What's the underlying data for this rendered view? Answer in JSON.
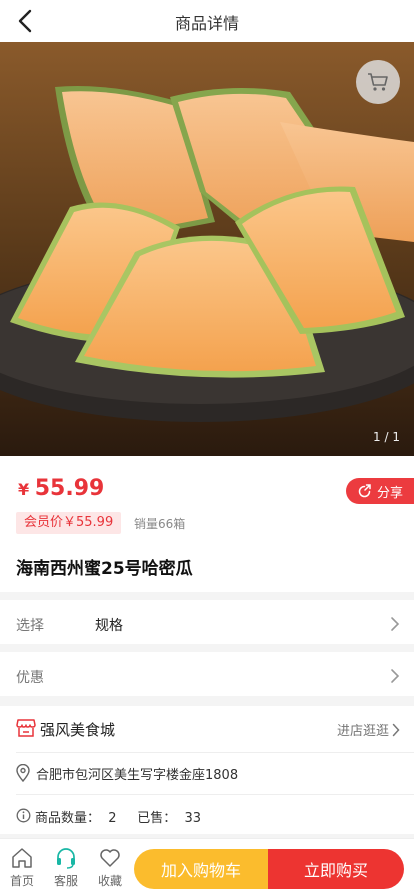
{
  "header": {
    "title": "商品详情"
  },
  "hero": {
    "pager": "1 / 1"
  },
  "product": {
    "currency": "¥",
    "price": "55.99",
    "share_label": "分享",
    "member_price": "会员价￥55.99",
    "sales": "销量66箱",
    "name": "海南西州蜜25号哈密瓜"
  },
  "spec_row": {
    "label": "选择",
    "value": "规格"
  },
  "promo_row": {
    "label": "优惠"
  },
  "store": {
    "name": "强风美食城",
    "visit_label": "进店逛逛",
    "address": "合肥市包河区美生写字楼金座1808",
    "count_text": "商品数量：  2     已售：  33"
  },
  "tabbar": {
    "home": "首页",
    "service": "客服",
    "favorite": "收藏",
    "add_to_cart": "加入购物车",
    "buy_now": "立即购买"
  },
  "colors": {
    "accent": "#e8343a",
    "cart_button": "#fbbc2d",
    "buy_button": "#ed3431",
    "service_icon": "#19b7a5"
  }
}
